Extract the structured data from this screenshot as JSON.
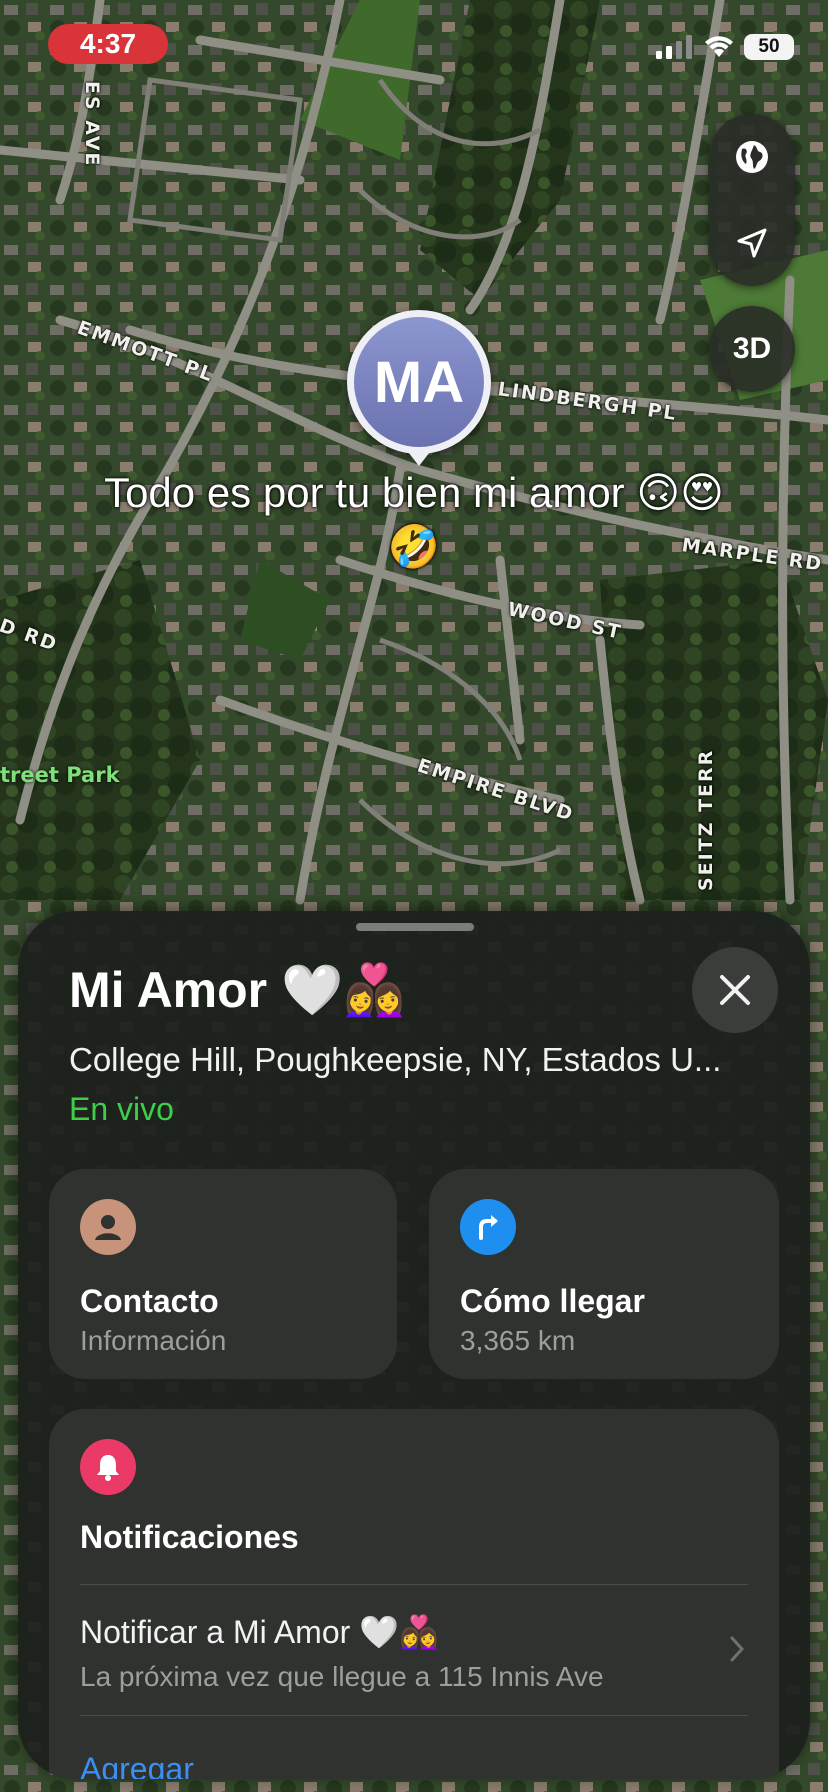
{
  "status_bar": {
    "time": "4:37",
    "battery": "50",
    "time_pill_color": "#d8343a"
  },
  "map": {
    "streets": [
      {
        "name": "EMMOTT PL"
      },
      {
        "name": "LINDBERGH PL"
      },
      {
        "name": "MARPLE RD"
      },
      {
        "name": "WOOD ST"
      },
      {
        "name": "EMPIRE BLVD"
      },
      {
        "name": "SEITZ TERR"
      },
      {
        "name": "ES AVE"
      },
      {
        "name": "D RD"
      }
    ],
    "park": "treet Park",
    "controls": {
      "globe_icon": "globe-icon",
      "location_icon": "location-arrow-icon",
      "mode_label": "3D"
    }
  },
  "pin": {
    "initials": "MA",
    "caption": "Todo es por tu bien mi amor 🙃😍🤣"
  },
  "sheet": {
    "title": "Mi Amor 🤍👩‍❤️‍👩",
    "address": "College Hill, Poughkeepsie, NY, Estados U...",
    "status": "En vivo",
    "contact": {
      "title": "Contacto",
      "subtitle": "Información",
      "icon": "person-icon",
      "color": "#c7937a"
    },
    "directions": {
      "title": "Cómo llegar",
      "subtitle": "3,365 km",
      "icon": "turn-arrow-icon",
      "color": "#1e8ff0"
    },
    "notifications": {
      "title": "Notificaciones",
      "icon": "bell-icon",
      "color": "#ec3a68",
      "row_title": "Notificar a Mi Amor 🤍👩‍❤️‍👩",
      "row_subtitle": "La próxima vez que llegue a 115 Innis Ave",
      "add_label": "Agregar"
    },
    "live_color": "#3ecf4a",
    "link_color": "#3a8ff2"
  }
}
